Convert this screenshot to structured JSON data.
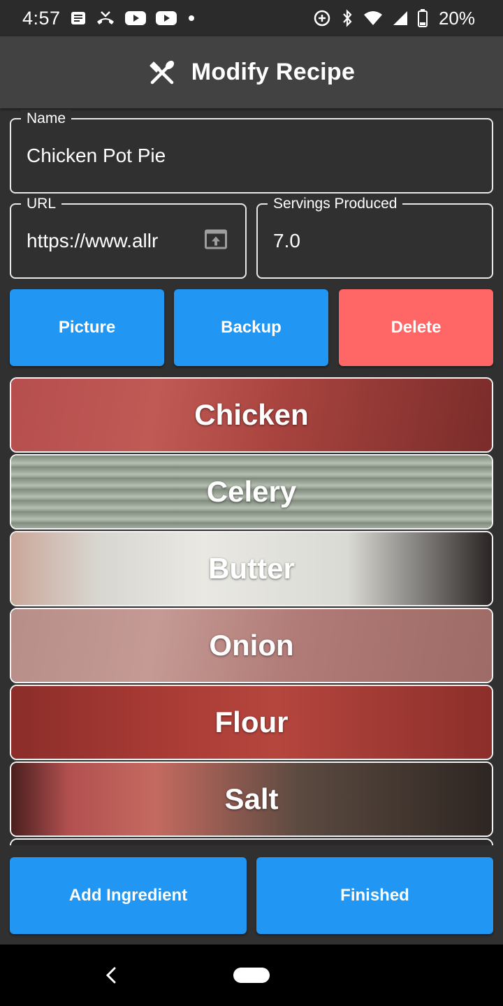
{
  "status_bar": {
    "time": "4:57",
    "battery": "20%",
    "left_icons": [
      "news-icon",
      "missed-call-icon",
      "youtube-icon",
      "youtube-icon",
      "dot-icon"
    ],
    "right_icons": [
      "data-saver-icon",
      "bluetooth-icon",
      "wifi-icon",
      "signal-icon",
      "battery-icon"
    ]
  },
  "app_bar": {
    "title": "Modify Recipe",
    "icon": "utensils-icon"
  },
  "form": {
    "name": {
      "label": "Name",
      "value": "Chicken Pot Pie"
    },
    "url": {
      "label": "URL",
      "value": "https://www.allr",
      "icon": "open-in-browser-icon"
    },
    "servings": {
      "label": "Servings Produced",
      "value": "7.0"
    }
  },
  "actions": {
    "picture": "Picture",
    "backup": "Backup",
    "delete": "Delete"
  },
  "ingredients": [
    {
      "name": "Chicken"
    },
    {
      "name": "Celery"
    },
    {
      "name": "Butter"
    },
    {
      "name": "Onion"
    },
    {
      "name": "Flour"
    },
    {
      "name": "Salt"
    }
  ],
  "bottom": {
    "add_ingredient": "Add Ingredient",
    "finished": "Finished"
  },
  "colors": {
    "primary": "#2196f3",
    "danger": "#ff6666",
    "background": "#303030",
    "app_bar": "#424242"
  }
}
